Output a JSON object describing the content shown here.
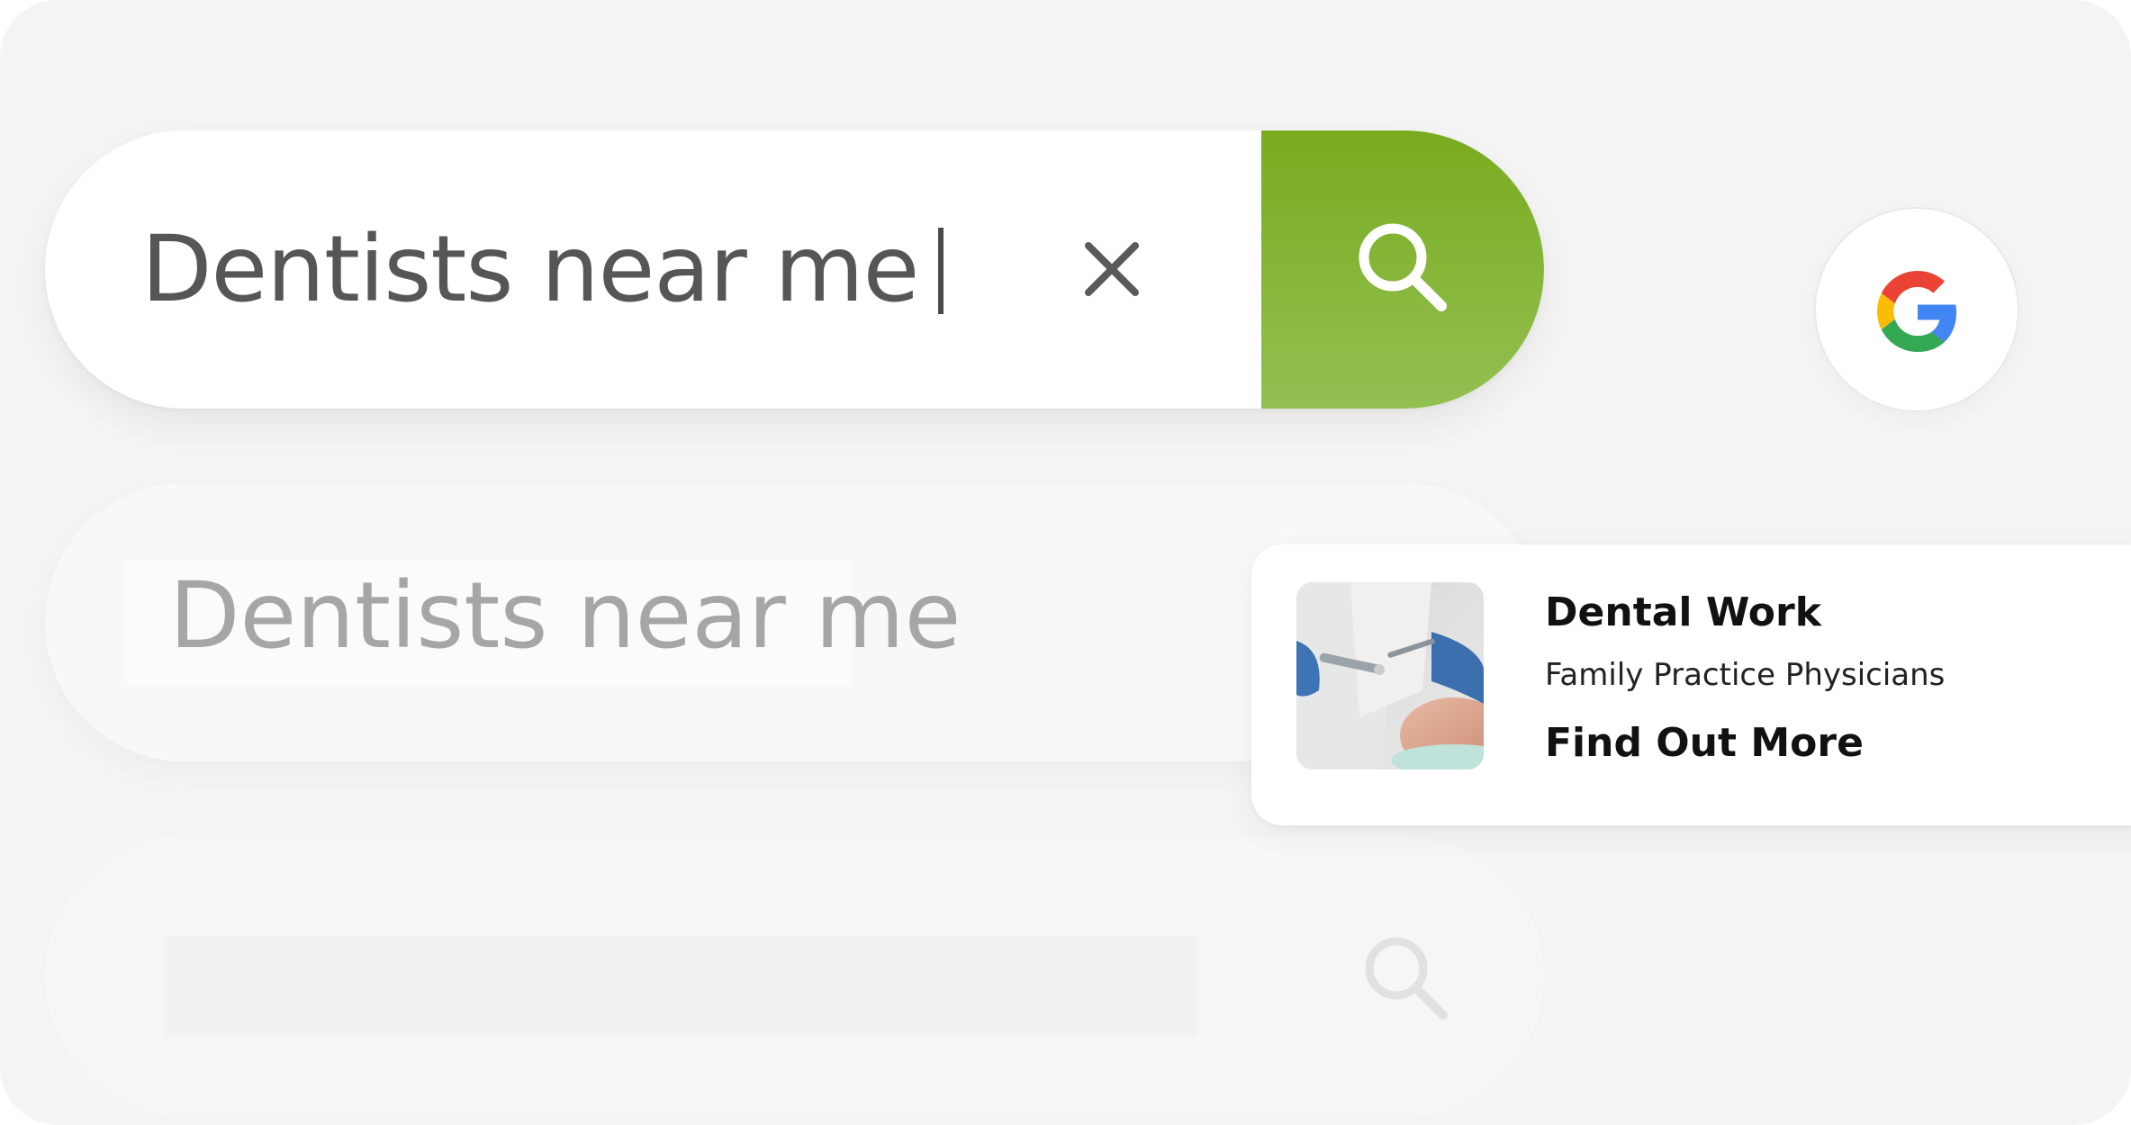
{
  "search": {
    "query": "Dentists near me",
    "clear_icon": "close-icon",
    "submit_icon": "search-icon",
    "accent_color": "#7fb026"
  },
  "google_button": {
    "icon": "google-g-logo",
    "colors": [
      "#4285F4",
      "#EA4335",
      "#FBBC05",
      "#34A853"
    ]
  },
  "suggestion": {
    "text": "Dentists near me"
  },
  "placeholder_bar": {
    "icon": "search-icon"
  },
  "ad": {
    "title": "Dental Work",
    "subtitle": "Family Practice Physicians",
    "cta": "Find Out More",
    "image": "dentist-treatment-photo"
  }
}
